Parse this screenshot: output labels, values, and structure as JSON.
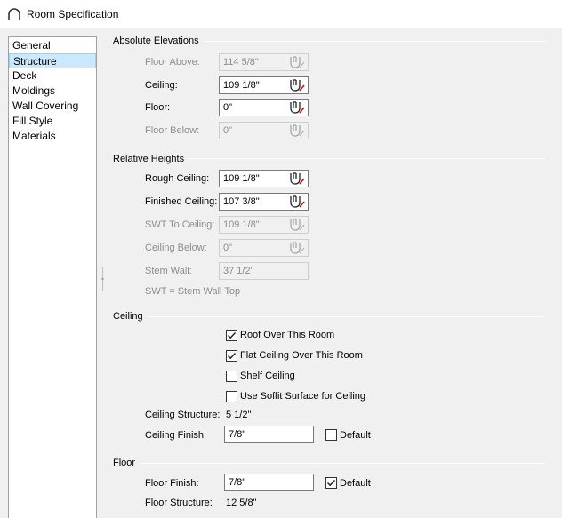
{
  "window": {
    "title": "Room Specification"
  },
  "nav": {
    "items": [
      "General",
      "Structure",
      "Deck",
      "Moldings",
      "Wall Covering",
      "Fill Style",
      "Materials"
    ],
    "selected": "Structure"
  },
  "absolute": {
    "title": "Absolute Elevations",
    "floor_above": {
      "label": "Floor Above:",
      "value": "114 5/8\""
    },
    "ceiling": {
      "label": "Ceiling:",
      "value": "109 1/8\""
    },
    "floor": {
      "label": "Floor:",
      "value": "0\""
    },
    "floor_below": {
      "label": "Floor Below:",
      "value": "0\""
    }
  },
  "relative": {
    "title": "Relative Heights",
    "rough_ceiling": {
      "label": "Rough Ceiling:",
      "value": "109 1/8\""
    },
    "finished_ceiling": {
      "label": "Finished Ceiling:",
      "value": "107 3/8\""
    },
    "swt_to_ceiling": {
      "label": "SWT To Ceiling:",
      "value": "109 1/8\""
    },
    "ceiling_below": {
      "label": "Ceiling Below:",
      "value": "0\""
    },
    "stem_wall": {
      "label": "Stem Wall:",
      "value": "37 1/2\""
    },
    "note": "SWT = Stem Wall Top"
  },
  "ceiling": {
    "title": "Ceiling",
    "roof_over": {
      "label": "Roof Over This Room",
      "checked": true
    },
    "flat_ceiling": {
      "label": "Flat Ceiling Over This Room",
      "checked": true
    },
    "shelf_ceiling": {
      "label": "Shelf Ceiling",
      "checked": false
    },
    "soffit_surface": {
      "label": "Use Soffit Surface for Ceiling",
      "checked": false
    },
    "structure": {
      "label": "Ceiling Structure:",
      "value": "5 1/2\""
    },
    "finish": {
      "label": "Ceiling Finish:",
      "value": "7/8\""
    },
    "finish_default": {
      "label": "Default",
      "checked": false
    }
  },
  "floor": {
    "title": "Floor",
    "finish": {
      "label": "Floor Finish:",
      "value": "7/8\""
    },
    "finish_default": {
      "label": "Default",
      "checked": true
    },
    "structure": {
      "label": "Floor Structure:",
      "value": "12 5/8\""
    }
  },
  "icons": {
    "title": "room-spec-arch-icon",
    "picker": "elevation-picker-icon"
  }
}
